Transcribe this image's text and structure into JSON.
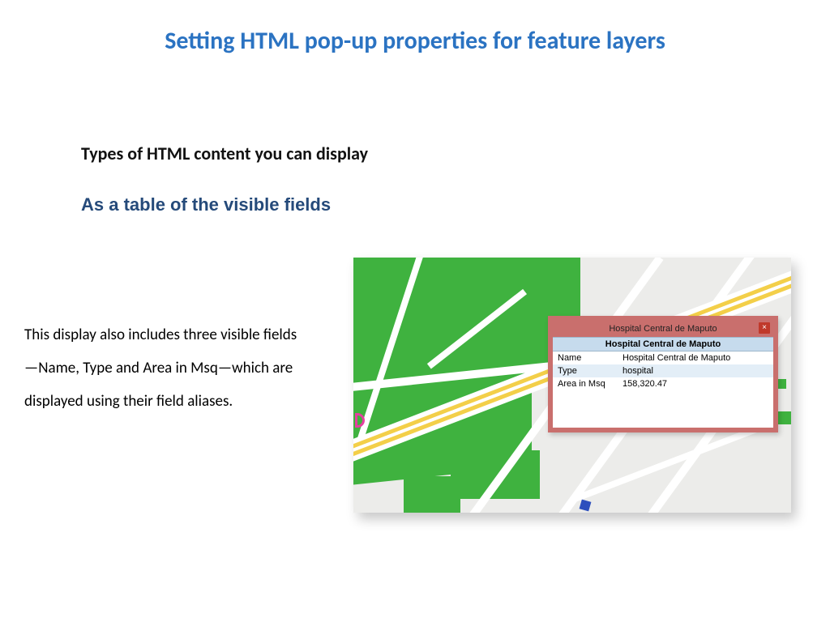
{
  "title": "Setting HTML pop-up properties for feature layers",
  "section_heading": "Types of HTML content you can display",
  "subtitle": "As a table of the visible fields",
  "body_text": "This display also includes three visible fields—Name, Type and Area in Msq—which are displayed using their field aliases.",
  "popup": {
    "window_title": "Hospital Central de Maputo",
    "header": "Hospital Central de Maputo",
    "close_glyph": "×",
    "rows": [
      {
        "label": "Name",
        "value": "Hospital Central de Maputo"
      },
      {
        "label": "Type",
        "value": "hospital"
      },
      {
        "label": "Area in Msq",
        "value": "158,320.47"
      }
    ]
  }
}
